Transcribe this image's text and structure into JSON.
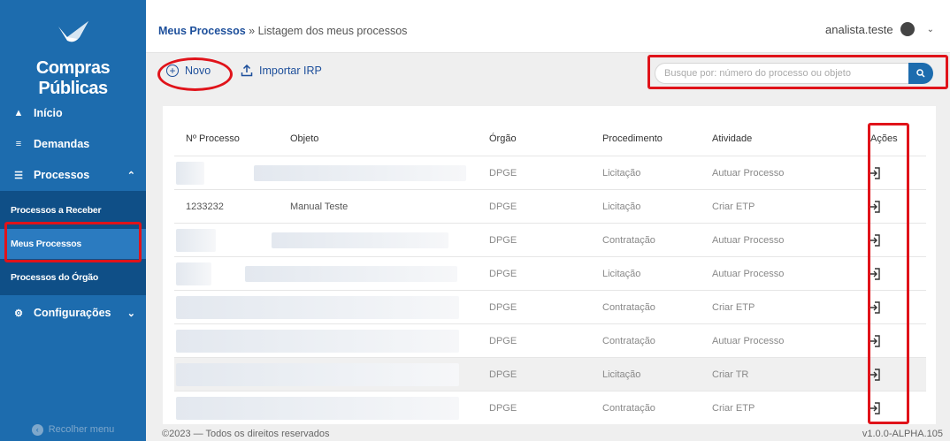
{
  "sidebar": {
    "brand": "Compras Públicas",
    "items": [
      {
        "label": "Início",
        "icon": "home-icon"
      },
      {
        "label": "Demandas",
        "icon": "list-icon"
      },
      {
        "label": "Processos",
        "icon": "menu-icon"
      },
      {
        "label": "Configurações",
        "icon": "gear-icon"
      }
    ],
    "subitems": [
      {
        "label": "Processos a Receber"
      },
      {
        "label": "Meus Processos",
        "active": true
      },
      {
        "label": "Processos do Órgão"
      }
    ],
    "collapse_label": "Recolher menu"
  },
  "header": {
    "breadcrumb_main": "Meus Processos",
    "breadcrumb_sub": " » Listagem dos meus processos",
    "username": "analista.teste"
  },
  "toolbar": {
    "new_label": "Novo",
    "import_label": "Importar IRP",
    "search_placeholder": "Busque por: número do processo ou objeto"
  },
  "table": {
    "columns": [
      "Nº Processo",
      "Objeto",
      "Órgão",
      "Procedimento",
      "Atividade",
      "Ações"
    ],
    "rows": [
      {
        "numero": "",
        "objeto": "",
        "orgao": "DPGE",
        "procedimento": "Licitação",
        "atividade": "Autuar Processo"
      },
      {
        "numero": "1233232",
        "objeto": "Manual Teste",
        "orgao": "DPGE",
        "procedimento": "Licitação",
        "atividade": "Criar ETP"
      },
      {
        "numero": "",
        "objeto": "",
        "orgao": "DPGE",
        "procedimento": "Contratação",
        "atividade": "Autuar Processo"
      },
      {
        "numero": "",
        "objeto": "",
        "orgao": "DPGE",
        "procedimento": "Licitação",
        "atividade": "Autuar Processo"
      },
      {
        "numero": "",
        "objeto": "",
        "orgao": "DPGE",
        "procedimento": "Contratação",
        "atividade": "Criar ETP"
      },
      {
        "numero": "",
        "objeto": "",
        "orgao": "DPGE",
        "procedimento": "Contratação",
        "atividade": "Autuar Processo"
      },
      {
        "numero": "",
        "objeto": "",
        "orgao": "DPGE",
        "procedimento": "Licitação",
        "atividade": "Criar TR"
      },
      {
        "numero": "",
        "objeto": "",
        "orgao": "DPGE",
        "procedimento": "Contratação",
        "atividade": "Criar ETP"
      }
    ]
  },
  "footer": {
    "copyright": "©2023 — Todos os direitos reservados",
    "version": "v1.0.0-ALPHA.105"
  },
  "colors": {
    "sidebar": "#1d6cae",
    "sidebar_sub": "#0f4f87",
    "highlight": "#e0131a",
    "link": "#1d4f9b"
  }
}
